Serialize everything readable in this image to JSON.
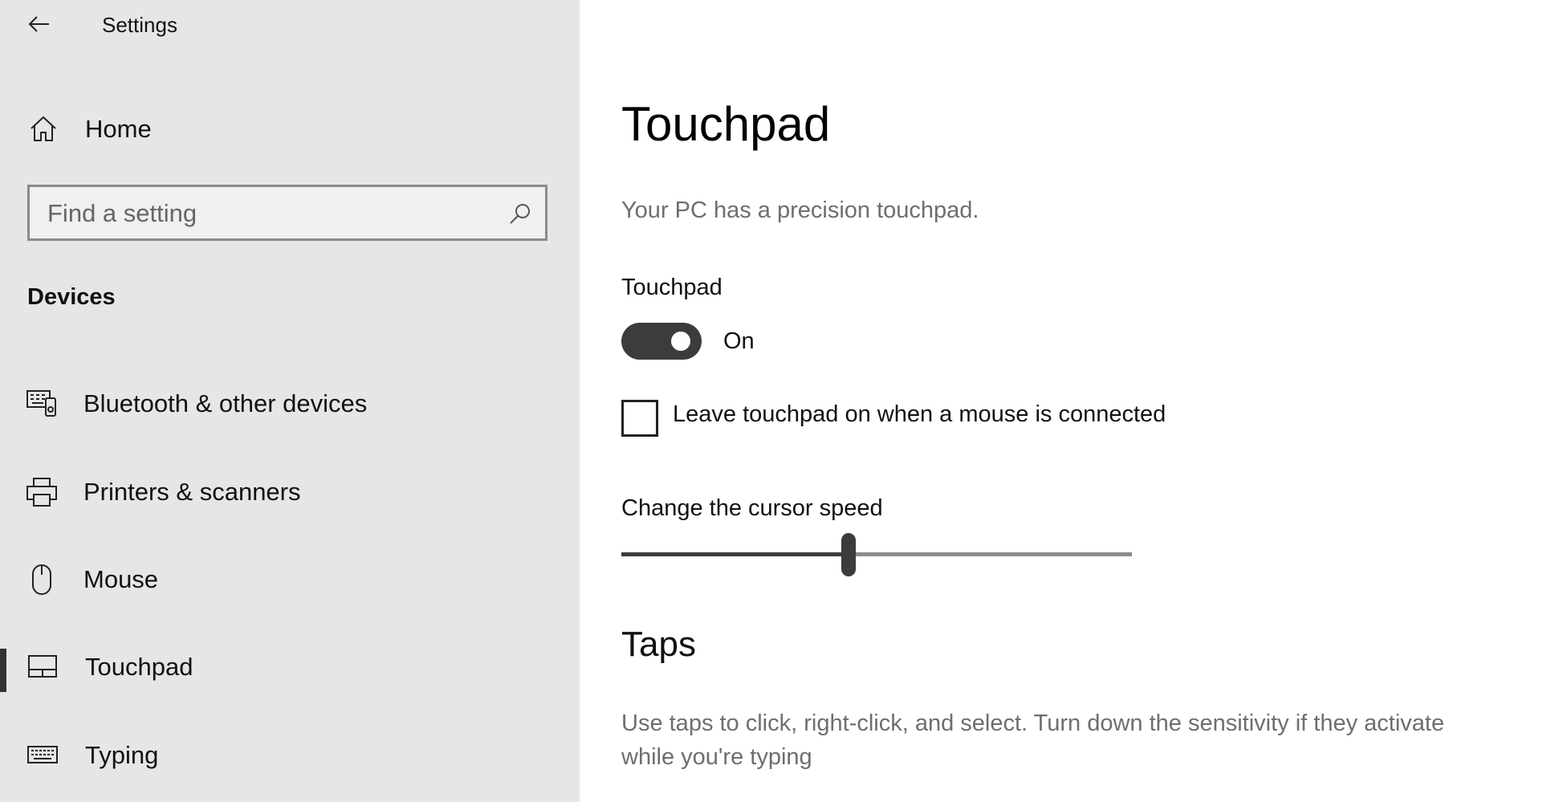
{
  "app": {
    "title": "Settings"
  },
  "sidebar": {
    "home_label": "Home",
    "search_placeholder": "Find a setting",
    "section_header": "Devices",
    "items": [
      {
        "label": "Bluetooth & other devices",
        "icon": "bluetooth-devices-icon",
        "selected": false
      },
      {
        "label": "Printers & scanners",
        "icon": "printer-icon",
        "selected": false
      },
      {
        "label": "Mouse",
        "icon": "mouse-icon",
        "selected": false
      },
      {
        "label": "Touchpad",
        "icon": "touchpad-icon",
        "selected": true
      },
      {
        "label": "Typing",
        "icon": "keyboard-icon",
        "selected": false
      }
    ]
  },
  "main": {
    "title": "Touchpad",
    "description": "Your PC has a precision touchpad.",
    "touchpad_toggle": {
      "label": "Touchpad",
      "state_text": "On",
      "on": true
    },
    "leave_on_checkbox": {
      "label": "Leave touchpad on when a mouse is connected",
      "checked": false
    },
    "cursor_speed": {
      "label": "Change the cursor speed",
      "value_fraction": 0.445
    },
    "taps": {
      "title": "Taps",
      "description": "Use taps to click, right-click, and select. Turn down the sensitivity if they activate while you're typing"
    }
  },
  "colors": {
    "sidebar_bg": "#e6e6e6",
    "accent_dark": "#3c3c3c",
    "secondary_text": "#6e6e6e"
  }
}
